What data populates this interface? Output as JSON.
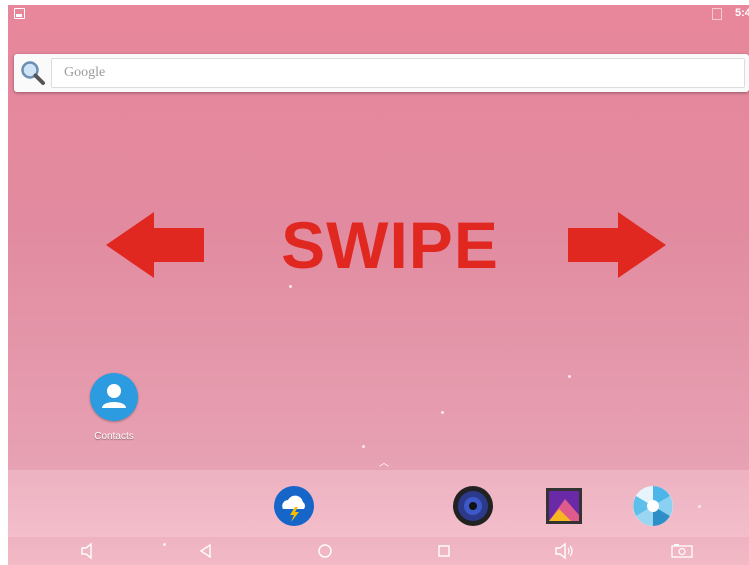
{
  "status_bar": {
    "time": "5:4"
  },
  "search": {
    "placeholder": "Google"
  },
  "overlay": {
    "text": "SWIPE",
    "color": "#e02820"
  },
  "desktop_apps": [
    {
      "label": "Contacts",
      "icon": "contacts-icon"
    }
  ],
  "dock": [
    {
      "icon": "weather-icon"
    },
    {
      "icon": "music-icon"
    },
    {
      "icon": "gallery-icon"
    },
    {
      "icon": "camera-icon"
    }
  ],
  "navigation": [
    {
      "icon": "volume-down-icon"
    },
    {
      "icon": "back-icon"
    },
    {
      "icon": "home-icon"
    },
    {
      "icon": "recents-icon"
    },
    {
      "icon": "volume-up-icon"
    },
    {
      "icon": "screenshot-icon"
    }
  ]
}
